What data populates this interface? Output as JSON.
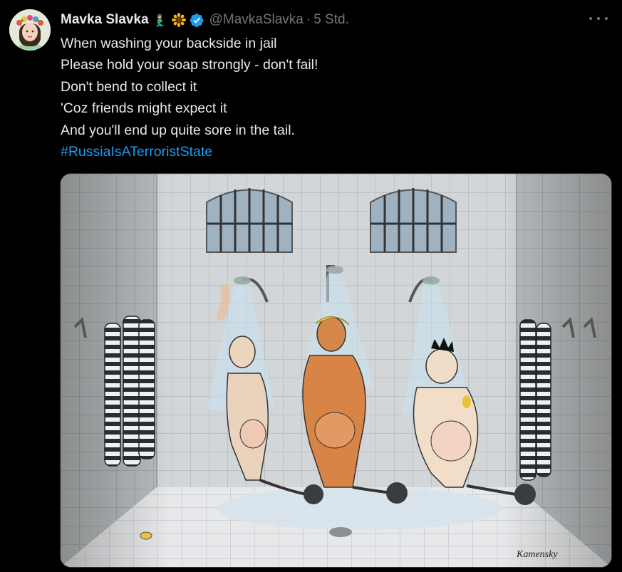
{
  "tweet": {
    "author_name": "Mavka Slavka",
    "author_handle": "@MavkaSlavka",
    "separator": "·",
    "timestamp": "5 Std.",
    "text_lines": [
      "When washing your backside in jail",
      "Please hold your soap strongly - don't fail!",
      "Don't bend to collect it",
      "'Coz friends might expect it",
      "And you'll end up quite sore in the tail."
    ],
    "hashtag": "#RussiaIsATerroristState",
    "image_signature": "Kamensky"
  },
  "icons": {
    "avatar": "avatar-icon",
    "emoji1": "mermaid-emoji-icon",
    "emoji2": "sunflower-emoji-icon",
    "verified": "verified-badge-icon",
    "more": "more-options-icon"
  },
  "colors": {
    "background": "#000000",
    "text_primary": "#e7e9ea",
    "text_secondary": "#71767b",
    "link": "#1d9bf0",
    "verified": "#1d9bf0"
  }
}
